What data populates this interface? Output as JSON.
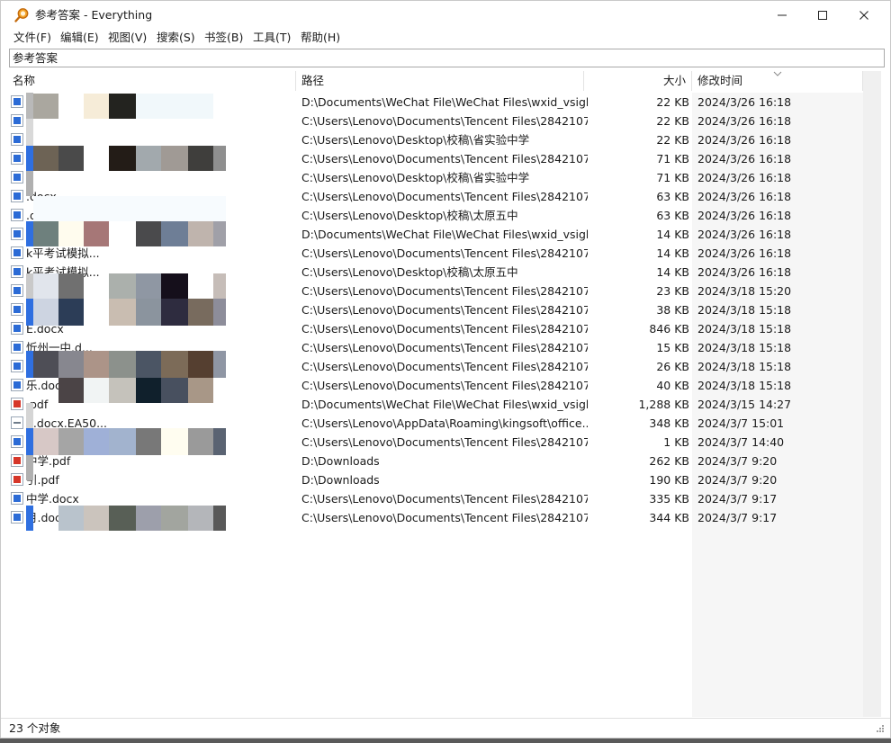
{
  "window": {
    "title": "参考答案 - Everything"
  },
  "menu": [
    "文件(F)",
    "编辑(E)",
    "视图(V)",
    "搜索(S)",
    "书签(B)",
    "工具(T)",
    "帮助(H)"
  ],
  "search": {
    "value": "参考答案"
  },
  "columns": {
    "name": "名称",
    "path": "路径",
    "size": "大小",
    "modified": "修改时间"
  },
  "files": [
    {
      "name": "",
      "path": "D:\\Documents\\WeChat File\\WeChat Files\\wxid_vsigb...",
      "size": "22 KB",
      "modified": "2024/3/26 16:18",
      "type": "doc"
    },
    {
      "name": "",
      "path": "C:\\Users\\Lenovo\\Documents\\Tencent Files\\2842107...",
      "size": "22 KB",
      "modified": "2024/3/26 16:18",
      "type": "doc"
    },
    {
      "name": "",
      "path": "C:\\Users\\Lenovo\\Desktop\\校稿\\省实验中学",
      "size": "22 KB",
      "modified": "2024/3/26 16:18",
      "type": "doc"
    },
    {
      "name": "x",
      "path": "C:\\Users\\Lenovo\\Documents\\Tencent Files\\2842107...",
      "size": "71 KB",
      "modified": "2024/3/26 16:18",
      "type": "doc"
    },
    {
      "name": "x",
      "path": "C:\\Users\\Lenovo\\Desktop\\校稿\\省实验中学",
      "size": "71 KB",
      "modified": "2024/3/26 16:18",
      "type": "doc"
    },
    {
      "name": ".docx",
      "path": "C:\\Users\\Lenovo\\Documents\\Tencent Files\\2842107...",
      "size": "63 KB",
      "modified": "2024/3/26 16:18",
      "type": "doc"
    },
    {
      "name": ".docx",
      "path": "C:\\Users\\Lenovo\\Desktop\\校稿\\太原五中",
      "size": "63 KB",
      "modified": "2024/3/26 16:18",
      "type": "doc"
    },
    {
      "name": "k平考试模拟...",
      "path": "D:\\Documents\\WeChat File\\WeChat Files\\wxid_vsigb...",
      "size": "14 KB",
      "modified": "2024/3/26 16:18",
      "type": "doc"
    },
    {
      "name": "k平考试模拟...",
      "path": "C:\\Users\\Lenovo\\Documents\\Tencent Files\\2842107...",
      "size": "14 KB",
      "modified": "2024/3/26 16:18",
      "type": "doc"
    },
    {
      "name": "k平考试模拟...",
      "path": "C:\\Users\\Lenovo\\Desktop\\校稿\\太原五中",
      "size": "14 KB",
      "modified": "2024/3/26 16:18",
      "type": "doc"
    },
    {
      "name": ".docx",
      "path": "C:\\Users\\Lenovo\\Documents\\Tencent Files\\2842107...",
      "size": "23 KB",
      "modified": "2024/3/18 15:20",
      "type": "doc"
    },
    {
      "name": "",
      "path": "C:\\Users\\Lenovo\\Documents\\Tencent Files\\2842107...",
      "size": "38 KB",
      "modified": "2024/3/18 15:18",
      "type": "doc"
    },
    {
      "name": "E.docx",
      "path": "C:\\Users\\Lenovo\\Documents\\Tencent Files\\2842107...",
      "size": "846 KB",
      "modified": "2024/3/18 15:18",
      "type": "doc"
    },
    {
      "name": "忻州一中.d...",
      "path": "C:\\Users\\Lenovo\\Documents\\Tencent Files\\2842107...",
      "size": "15 KB",
      "modified": "2024/3/18 15:18",
      "type": "doc"
    },
    {
      "name": "乐.docx",
      "path": "C:\\Users\\Lenovo\\Documents\\Tencent Files\\2842107...",
      "size": "26 KB",
      "modified": "2024/3/18 15:18",
      "type": "doc"
    },
    {
      "name": "乐.docx",
      "path": "C:\\Users\\Lenovo\\Documents\\Tencent Files\\2842107...",
      "size": "40 KB",
      "modified": "2024/3/18 15:18",
      "type": "doc"
    },
    {
      "name": ".pdf",
      "path": "D:\\Documents\\WeChat File\\WeChat Files\\wxid_vsigb...",
      "size": "1,288 KB",
      "modified": "2024/3/15 14:27",
      "type": "pdf"
    },
    {
      "name": "d.docx.EA50...",
      "path": "C:\\Users\\Lenovo\\AppData\\Roaming\\kingsoft\\office...",
      "size": "348 KB",
      "modified": "2024/3/7 15:01",
      "type": "txt"
    },
    {
      "name": "月.docx",
      "path": "C:\\Users\\Lenovo\\Documents\\Tencent Files\\2842107...",
      "size": "1 KB",
      "modified": "2024/3/7 14:40",
      "type": "doc"
    },
    {
      "name": "中学.pdf",
      "path": "D:\\Downloads",
      "size": "262 KB",
      "modified": "2024/3/7 9:20",
      "type": "pdf"
    },
    {
      "name": "引.pdf",
      "path": "D:\\Downloads",
      "size": "190 KB",
      "modified": "2024/3/7 9:20",
      "type": "pdf"
    },
    {
      "name": "中学.docx",
      "path": "C:\\Users\\Lenovo\\Documents\\Tencent Files\\2842107...",
      "size": "335 KB",
      "modified": "2024/3/7 9:17",
      "type": "doc"
    },
    {
      "name": "月.docx",
      "path": "C:\\Users\\Lenovo\\Documents\\Tencent Files\\2842107...",
      "size": "344 KB",
      "modified": "2024/3/7 9:17",
      "type": "doc"
    }
  ],
  "status": {
    "text": "23 个对象"
  },
  "colors": {
    "doc": "#2b6bd6",
    "pdf": "#d6372b",
    "txt": "#6f7c8a",
    "date_bg": "#f6f6f6"
  },
  "icons": {
    "app": "search-magnifier-icon",
    "minimize": "minimize-icon",
    "maximize": "maximize-icon",
    "close": "close-icon"
  }
}
